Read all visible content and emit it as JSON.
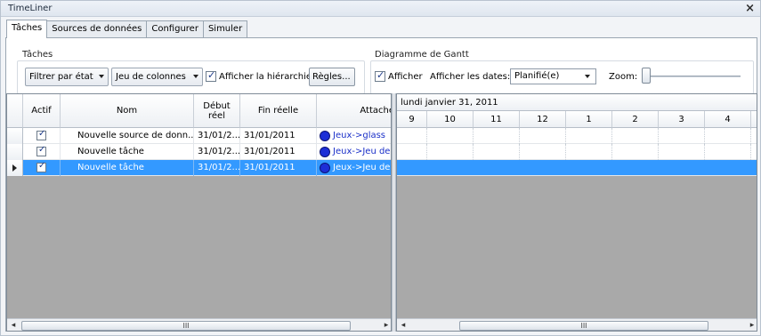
{
  "window": {
    "title": "TimeLiner",
    "close_glyph": "×"
  },
  "tabs": [
    {
      "label": "Tâches",
      "active": true
    },
    {
      "label": "Sources de données",
      "active": false
    },
    {
      "label": "Configurer",
      "active": false
    },
    {
      "label": "Simuler",
      "active": false
    }
  ],
  "tasks_group": {
    "title": "Tâches",
    "filter_label": "Filtrer par état",
    "columns_label": "Jeu de colonnes",
    "show_hierarchy_label": "Afficher la hiérarchie",
    "show_hierarchy_checked": true,
    "rules_label": "Règles..."
  },
  "gantt_group": {
    "title": "Diagramme de Gantt",
    "show_label": "Afficher",
    "show_checked": true,
    "show_dates_label": "Afficher les dates:",
    "dates_value": "Planifié(e)",
    "zoom_label": "Zoom:",
    "zoom_level": 0.0
  },
  "grid": {
    "columns": [
      "Actif",
      "Nom",
      "Début réel",
      "Fin réelle",
      "Attaché"
    ],
    "rows": [
      {
        "active": true,
        "name": "Nouvelle source de donn...",
        "start": "31/01/2...",
        "end": "31/01/2011",
        "attached": "Jeux->glass",
        "selected": false
      },
      {
        "active": true,
        "name": "Nouvelle tâche",
        "start": "31/01/2...",
        "end": "31/01/2011",
        "attached": "Jeux->Jeu de",
        "selected": false
      },
      {
        "active": true,
        "name": "Nouvelle tâche",
        "start": "31/01/2...",
        "end": "31/01/2011",
        "attached": "Jeux->Jeu de",
        "selected": true
      }
    ]
  },
  "gantt": {
    "date_header": "lundi janvier 31, 2011",
    "hours": [
      "9",
      "10",
      "11",
      "12",
      "1",
      "2",
      "3",
      "4"
    ]
  },
  "scrollbars": {
    "left_arrow": "◂",
    "right_arrow": "▸",
    "grip": "III"
  },
  "icons": {
    "checkbox_mark": "✓",
    "row_indicator": "row-indicator-icon",
    "attached_item": "attached-item-icon"
  }
}
